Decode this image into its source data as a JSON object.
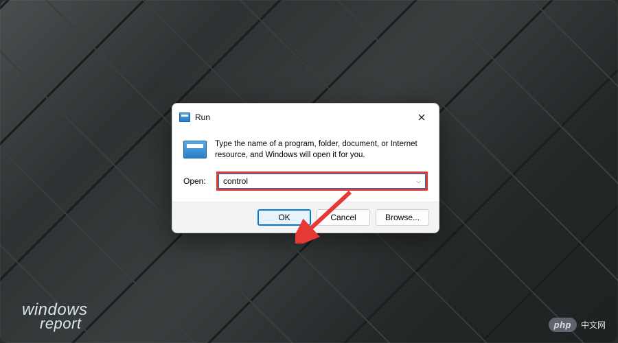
{
  "dialog": {
    "title": "Run",
    "description": "Type the name of a program, folder, document, or Internet resource, and Windows will open it for you.",
    "open_label": "Open:",
    "input_value": "control",
    "buttons": {
      "ok": "OK",
      "cancel": "Cancel",
      "browse": "Browse..."
    }
  },
  "watermarks": {
    "left_line1": "windows",
    "left_line2": "report",
    "right_badge": "php",
    "right_text": "中文网"
  }
}
